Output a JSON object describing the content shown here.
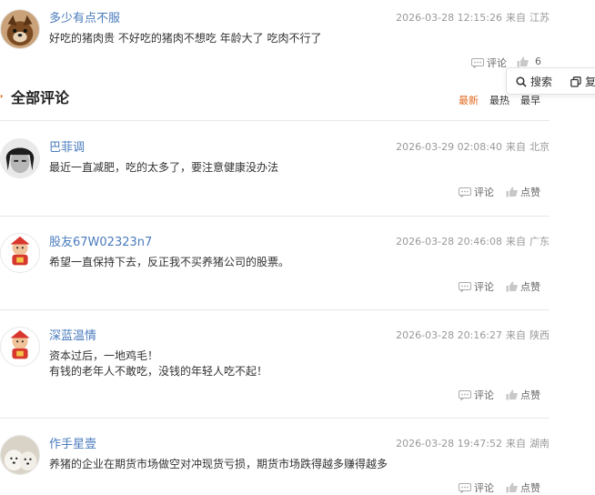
{
  "top_comment": {
    "username": "多少有点不服",
    "timestamp": "2026-03-28 12:15:26",
    "from_label": "来自",
    "location": "江苏",
    "text": "好吃的猪肉贵 不好吃的猪肉不想吃 年龄大了 吃肉不行了",
    "reply_label": "评论",
    "like_count": "6"
  },
  "floating_toolbar": {
    "search_label": "搜索",
    "copy_label": "复"
  },
  "section": {
    "title": "全部评论",
    "sort_latest": "最新",
    "sort_hot": "最热",
    "sort_earliest": "最早"
  },
  "comments": [
    {
      "username": "巴菲调",
      "timestamp": "2026-03-29 02:08:40",
      "from_label": "来自",
      "location": "北京",
      "text_lines": [
        "最近一直减肥，吃的太多了，要注意健康没办法"
      ],
      "reply_label": "评论",
      "like_label": "点赞"
    },
    {
      "username": "股友67W02323n7",
      "timestamp": "2026-03-28 20:46:08",
      "from_label": "来自",
      "location": "广东",
      "text_lines": [
        "希望一直保持下去，反正我不买养猪公司的股票。"
      ],
      "reply_label": "评论",
      "like_label": "点赞"
    },
    {
      "username": "深蓝温情",
      "timestamp": "2026-03-28 20:16:27",
      "from_label": "来自",
      "location": "陕西",
      "text_lines": [
        "资本过后，一地鸡毛！",
        "有钱的老年人不敢吃，没钱的年轻人吃不起！"
      ],
      "reply_label": "评论",
      "like_label": "点赞"
    },
    {
      "username": "作手星壹",
      "timestamp": "2026-03-28 19:47:52",
      "from_label": "来自",
      "location": "湖南",
      "text_lines": [
        "养猪的企业在期货市场做空对冲现货亏损，期货市场跌得越多赚得越多"
      ],
      "reply_label": "评论",
      "like_label": "点赞"
    }
  ],
  "colors": {
    "username": "#4a7bbd",
    "active_sort": "#e06a1f",
    "meta": "#999999"
  }
}
